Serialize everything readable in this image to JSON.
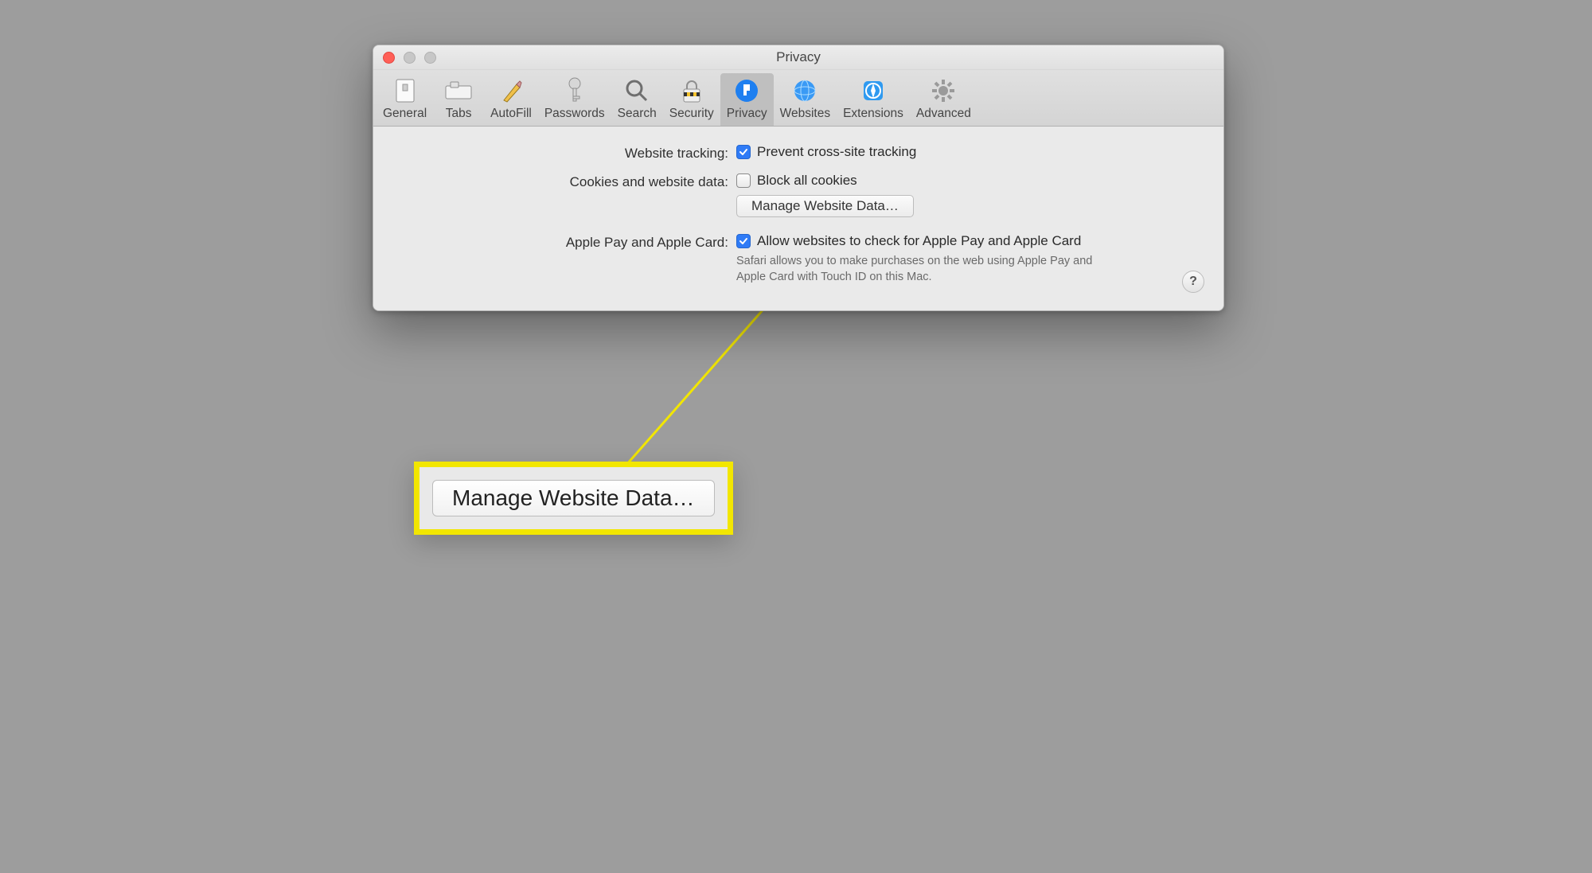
{
  "window": {
    "title": "Privacy"
  },
  "toolbar": {
    "items": [
      {
        "id": "general",
        "label": "General"
      },
      {
        "id": "tabs",
        "label": "Tabs"
      },
      {
        "id": "autofill",
        "label": "AutoFill"
      },
      {
        "id": "passwords",
        "label": "Passwords"
      },
      {
        "id": "search",
        "label": "Search"
      },
      {
        "id": "security",
        "label": "Security"
      },
      {
        "id": "privacy",
        "label": "Privacy",
        "selected": true
      },
      {
        "id": "websites",
        "label": "Websites"
      },
      {
        "id": "extensions",
        "label": "Extensions"
      },
      {
        "id": "advanced",
        "label": "Advanced"
      }
    ]
  },
  "privacy": {
    "website_tracking": {
      "label": "Website tracking:",
      "checkbox_label": "Prevent cross-site tracking",
      "checked": true
    },
    "cookies": {
      "label": "Cookies and website data:",
      "checkbox_label": "Block all cookies",
      "checked": false,
      "manage_button": "Manage Website Data…"
    },
    "apple_pay": {
      "label": "Apple Pay and Apple Card:",
      "checkbox_label": "Allow websites to check for Apple Pay and Apple Card",
      "checked": true,
      "description": "Safari allows you to make purchases on the web using Apple Pay and Apple Card with Touch ID on this Mac."
    },
    "help": "?"
  },
  "callout": {
    "button": "Manage Website Data…"
  }
}
